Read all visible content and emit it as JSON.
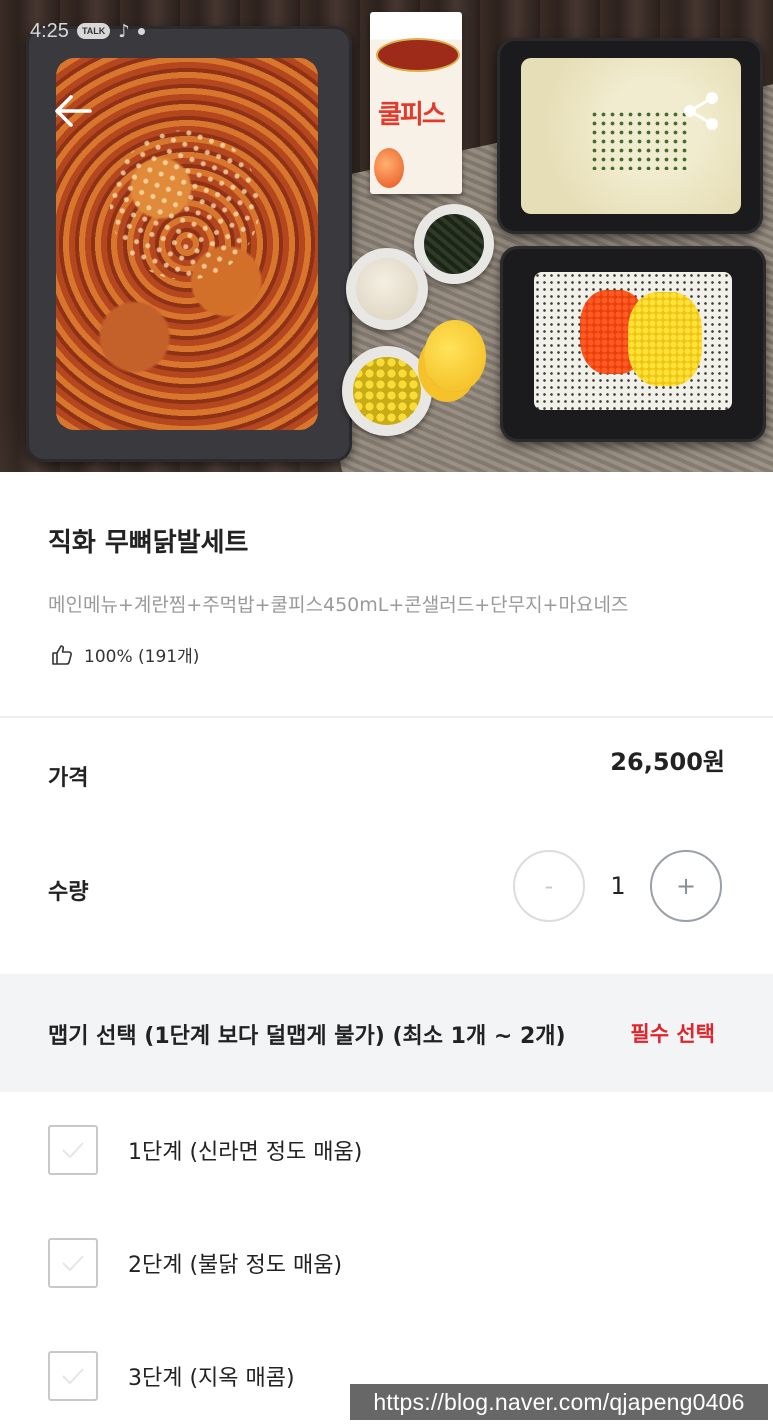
{
  "status_bar": {
    "time": "4:25",
    "talk_badge": "TALK"
  },
  "hero": {
    "carton_brand": "쿨피스"
  },
  "product": {
    "title": "직화 무뼈닭발세트",
    "description": "메인메뉴+계란찜+주먹밥+쿨피스450mL+콘샐러드+단무지+마요네즈",
    "rating": "100% (191개)"
  },
  "price": {
    "label": "가격",
    "value": "26,500원"
  },
  "quantity": {
    "label": "수량",
    "minus": "-",
    "value": "1",
    "plus": "+"
  },
  "option_group": {
    "title": "맵기 선택 (1단계 보다 덜맵게 불가) (최소 1개 ~ 2개)",
    "required": "필수 선택",
    "items": [
      {
        "label": "1단계 (신라면 정도 매움)",
        "checked": false
      },
      {
        "label": "2단계 (불닭 정도 매움)",
        "checked": false
      },
      {
        "label": "3단계 (지옥 매콤)",
        "checked": false
      }
    ]
  },
  "watermark": "https://blog.naver.com/qjapeng0406",
  "colors": {
    "required_red": "#e0242b",
    "option_header_bg": "#f3f4f6",
    "description_gray": "#9a9a9a"
  },
  "icons": [
    "back-arrow-icon",
    "share-icon",
    "thumbs-up-icon",
    "check-icon"
  ]
}
